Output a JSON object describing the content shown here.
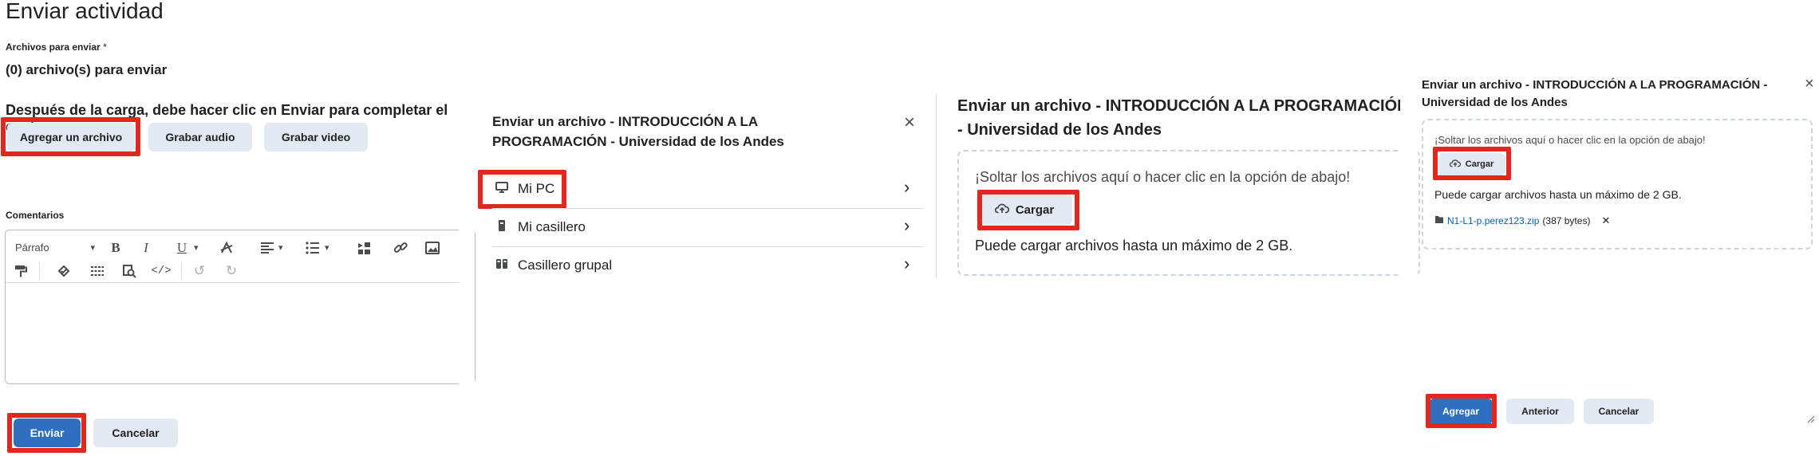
{
  "panel1": {
    "title": "Enviar actividad",
    "files_label": "Archivos para enviar",
    "required_mark": "*",
    "files_count": "(0) archivo(s) para enviar",
    "instruction": "Después de la carga, debe hacer clic en Enviar para completar el envío.",
    "btn_add_file": "Agregar un archivo",
    "btn_record_audio": "Grabar audio",
    "btn_record_video": "Grabar video",
    "comments_label": "Comentarios",
    "format_select": "Párrafo",
    "btn_submit": "Enviar",
    "btn_cancel": "Cancelar"
  },
  "panel2": {
    "title": "Enviar un archivo - INTRODUCCIÓN A LA PROGRAMACIÓN - Universidad de los Andes",
    "close": "×",
    "items": [
      {
        "label": "Mi PC",
        "icon": "computer-icon"
      },
      {
        "label": "Mi casillero",
        "icon": "locker-icon"
      },
      {
        "label": "Casillero grupal",
        "icon": "group-locker-icon"
      }
    ]
  },
  "panel3": {
    "title": "Enviar un archivo - INTRODUCCIÓN A LA PROGRAMACIÓN - Universidad de los Andes",
    "drop_text": "¡Soltar los archivos aquí o hacer clic en la opción de abajo!",
    "btn_upload": "Cargar",
    "limit_text": "Puede cargar archivos hasta un máximo de 2 GB."
  },
  "panel4": {
    "title": "Enviar un archivo - INTRODUCCIÓN A LA PROGRAMACIÓN - Universidad de los Andes",
    "close": "×",
    "drop_text": "¡Soltar los archivos aquí o hacer clic en la opción de abajo!",
    "btn_upload": "Cargar",
    "limit_text": "Puede cargar archivos hasta un máximo de 2 GB.",
    "file_name": "N1-L1-p.perez123.zip",
    "file_size": "(387 bytes)",
    "remove": "✕",
    "btn_add": "Agregar",
    "btn_previous": "Anterior",
    "btn_cancel": "Cancelar"
  },
  "colors": {
    "highlight": "#e0281f",
    "primary": "#2f6fbf",
    "secondary_bg": "#e3e9f1",
    "link": "#0062b3"
  }
}
